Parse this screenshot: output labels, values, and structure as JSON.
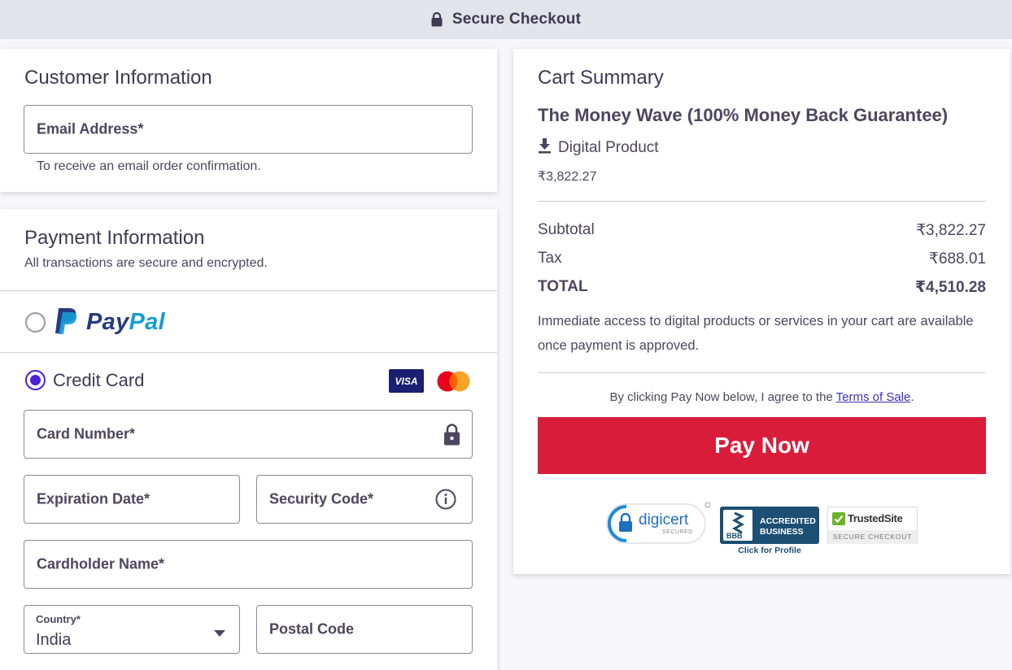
{
  "header": {
    "title": "Secure Checkout"
  },
  "customer": {
    "heading": "Customer Information",
    "email_placeholder": "Email Address*",
    "email_helper": "To receive an email order confirmation."
  },
  "payment": {
    "heading": "Payment Information",
    "subheading": "All transactions are secure and encrypted.",
    "paypal": {
      "label_pay": "Pay",
      "label_pal": "Pal",
      "selected": false
    },
    "credit_card": {
      "label": "Credit Card",
      "selected": true,
      "visa_label": "VISA"
    },
    "card_number_placeholder": "Card Number*",
    "expiration_placeholder": "Expiration Date*",
    "security_code_placeholder": "Security Code*",
    "cardholder_placeholder": "Cardholder Name*",
    "country": {
      "label": "Country*",
      "value": "India"
    },
    "postal_placeholder": "Postal Code"
  },
  "cart": {
    "heading": "Cart Summary",
    "product_name": "The Money Wave (100% Money Back Guarantee)",
    "product_type": "Digital Product",
    "product_price": "₹3,822.27",
    "subtotal_label": "Subtotal",
    "subtotal_value": "₹3,822.27",
    "tax_label": "Tax",
    "tax_value": "₹688.01",
    "total_label": "TOTAL",
    "total_value": "₹4,510.28",
    "access_note": "Immediate access to digital products or services in your cart are available once payment is approved.",
    "terms_prefix": "By clicking Pay Now below, I agree to the ",
    "terms_link": "Terms of Sale",
    "terms_suffix": ".",
    "pay_button": "Pay Now"
  },
  "badges": {
    "digicert_name": "digicert",
    "digicert_sub": "SECURED",
    "bbb_logo": "BBB",
    "bbb_line1": "ACCREDITED",
    "bbb_line2": "BUSINESS",
    "bbb_caption": "Click for Profile",
    "trusted_name": "TrustedSite",
    "trusted_sub": "SECURE CHECKOUT"
  },
  "colors": {
    "accent": "#4b22d6",
    "pay_button": "#da1c3b",
    "paypal_dark": "#253b80",
    "paypal_light": "#179bd7"
  }
}
